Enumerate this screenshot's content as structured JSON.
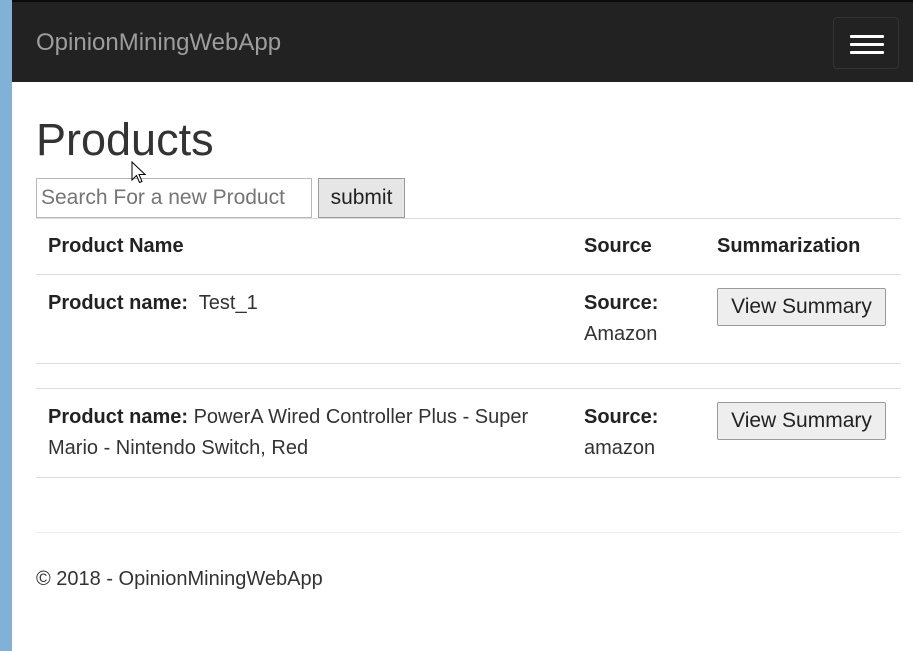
{
  "navbar": {
    "brand": "OpinionMiningWebApp",
    "toggle_icon": "hamburger-icon"
  },
  "page": {
    "title": "Products"
  },
  "search": {
    "placeholder": "Search For a new Product",
    "value": "",
    "submit_label": "submit"
  },
  "table": {
    "headers": {
      "name": "Product Name",
      "source": "Source",
      "summarization": "Summarization"
    },
    "rows": [
      {
        "name_label": "Product name:",
        "name": "Test_1",
        "source_label": "Source:",
        "source": "Amazon",
        "action": "View Summary"
      },
      {
        "name_label": "Product name:",
        "name": "PowerA Wired Controller Plus - Super Mario - Nintendo Switch, Red",
        "source_label": "Source:",
        "source": "amazon",
        "action": "View Summary"
      }
    ]
  },
  "footer": {
    "text": "© 2018 - OpinionMiningWebApp"
  },
  "colors": {
    "navbar_bg": "#222222",
    "brand_text": "#9d9d9d",
    "button_bg": "#eeeeee"
  }
}
